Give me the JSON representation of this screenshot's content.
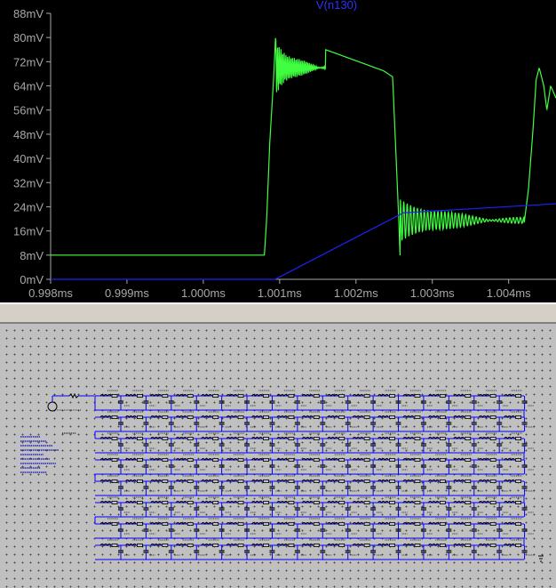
{
  "chart_data": {
    "type": "line",
    "title": "V(n130)",
    "x_ticks": [
      "0.998ms",
      "0.999ms",
      "1.000ms",
      "1.001ms",
      "1.002ms",
      "1.003ms",
      "1.004ms"
    ],
    "x_tick_values": [
      0.998,
      0.999,
      1.0,
      1.001,
      1.002,
      1.003,
      1.004
    ],
    "y_ticks": [
      "0mV",
      "8mV",
      "16mV",
      "24mV",
      "32mV",
      "40mV",
      "48mV",
      "56mV",
      "64mV",
      "72mV",
      "80mV",
      "88mV"
    ],
    "y_tick_values": [
      0,
      8,
      16,
      24,
      32,
      40,
      48,
      56,
      64,
      72,
      80,
      88
    ],
    "xlim": [
      0.998,
      1.00462
    ],
    "ylim": [
      0,
      88
    ],
    "grid": false,
    "series": [
      {
        "color": "#40ff40",
        "x": [
          0.998,
          1.0008,
          1.00083,
          1.00087,
          1.00092,
          1.00095,
          1.00236,
          1.00248,
          1.00256,
          1.00258,
          1.00275,
          1.0042,
          1.00426,
          1.00432,
          1.00436,
          1.0044,
          1.00446,
          1.0045,
          1.00455,
          1.00462
        ],
        "y": [
          8,
          8,
          20,
          45,
          66,
          82,
          69,
          67,
          20,
          6,
          20,
          18,
          30,
          50,
          66,
          70,
          64,
          56,
          64,
          60
        ],
        "ringing": [
          {
            "start": 1.00095,
            "end": 1.0016,
            "center": 70,
            "amplitude": 9,
            "period": 2.2e-05
          },
          {
            "start": 1.00258,
            "end": 1.0042,
            "center": 19.5,
            "amplitude": 7,
            "period": 4.5e-05
          }
        ]
      },
      {
        "color": "#2020ff",
        "x": [
          0.998,
          1.00094,
          1.00262,
          1.00462
        ],
        "y": [
          0,
          0,
          22,
          25
        ]
      }
    ]
  },
  "schematic": {
    "wire_color": "#0000ff",
    "component_color": "#000000",
    "rows": 8,
    "cells_per_row": 17,
    "notes": [
      "",
      "",
      "",
      "",
      "",
      "",
      "",
      "",
      ""
    ]
  }
}
